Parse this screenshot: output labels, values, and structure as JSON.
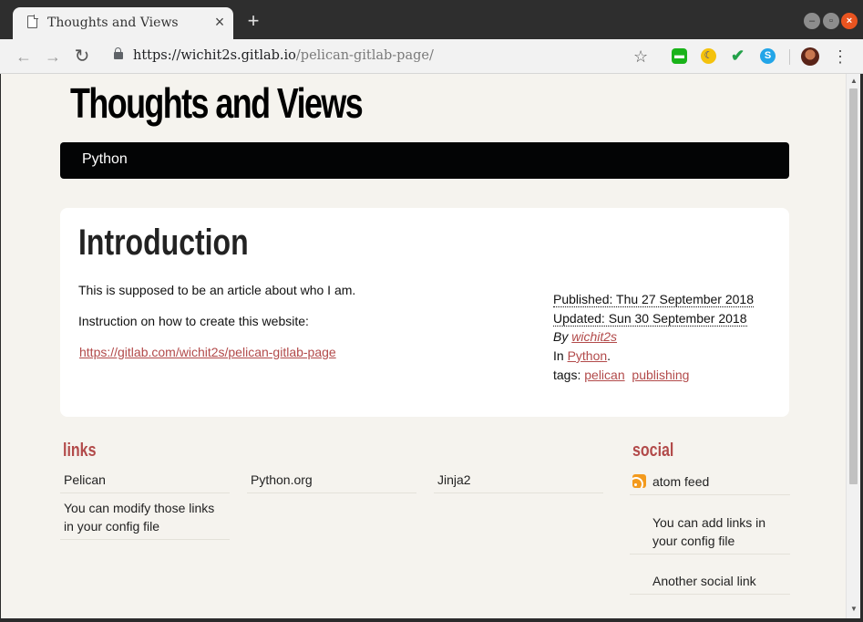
{
  "browser": {
    "tab_title": "Thoughts and Views",
    "tab_close": "×",
    "new_tab": "+",
    "url_host": "https://wichit2s.gitlab.io",
    "url_path": "/pelican-gitlab-page/"
  },
  "icons": {
    "back": "arrow-left-icon",
    "forward": "arrow-right-icon",
    "reload": "reload-icon",
    "lock": "lock-icon",
    "bookmark": "star-icon",
    "extensions": [
      "line-icon",
      "night-moon-icon",
      "checkmark-icon",
      "skype-icon"
    ],
    "profile": "avatar",
    "menu": "kebab-menu-icon",
    "feed": "rss-icon"
  },
  "site": {
    "title": "Thoughts and Views",
    "nav": [
      "Python"
    ]
  },
  "article": {
    "title": "Introduction",
    "paragraphs": [
      "This is supposed to be an article about who I am.",
      "Instruction on how to create this website:"
    ],
    "link": "https://gitlab.com/wichit2s/pelican-gitlab-page",
    "meta": {
      "published": "Published: Thu 27 September 2018",
      "updated": "Updated: Sun 30 September 2018",
      "by_label": "By",
      "author": "wichit2s",
      "in_label": "In",
      "category": "Python",
      "period": ".",
      "tags_label": "tags:",
      "tags": [
        "pelican",
        "publishing"
      ]
    }
  },
  "blogroll": {
    "heading": "links",
    "items": [
      "Pelican",
      "Python.org",
      "Jinja2",
      "You can modify those links in your config file"
    ]
  },
  "social": {
    "heading": "social",
    "items": [
      "atom feed",
      "You can add links in your config file",
      "Another social link"
    ]
  },
  "colors": {
    "accent": "#b24a4a",
    "menubar": "#030405",
    "page_bg": "#f5f3ee"
  }
}
